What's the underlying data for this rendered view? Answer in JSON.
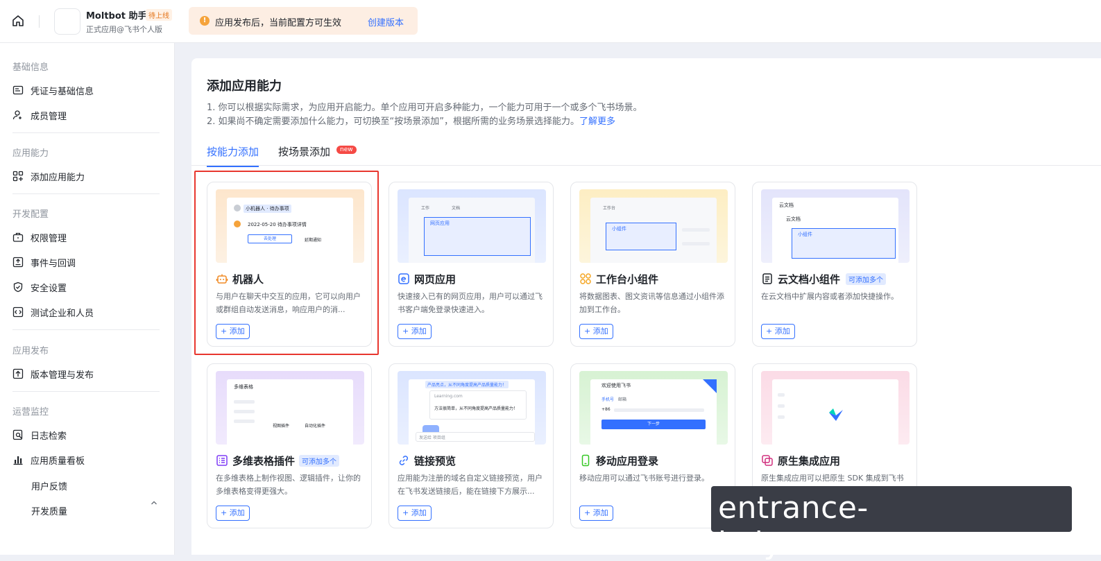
{
  "topbar": {
    "app_name": "Moltbot 助手",
    "status_badge": "待上线",
    "app_subtitle": "正式应用@飞书个人版",
    "notice_text": "应用发布后，当前配置方可生效",
    "notice_link": "创建版本"
  },
  "sidebar": {
    "sections": [
      {
        "title": "基础信息",
        "items": [
          "凭证与基础信息",
          "成员管理"
        ]
      },
      {
        "title": "应用能力",
        "items": [
          "添加应用能力"
        ]
      },
      {
        "title": "开发配置",
        "items": [
          "权限管理",
          "事件与回调",
          "安全设置",
          "测试企业和人员"
        ]
      },
      {
        "title": "应用发布",
        "items": [
          "版本管理与发布"
        ]
      },
      {
        "title": "运营监控",
        "items": [
          "日志检索",
          "应用质量看板"
        ],
        "subitems": [
          "用户反馈",
          "开发质量"
        ]
      }
    ]
  },
  "main": {
    "title": "添加应用能力",
    "desc1": "1. 你可以根据实际需求，为应用开启能力。单个应用可开启多种能力，一个能力可用于一个或多个飞书场景。",
    "desc2": "2. 如果尚不确定需要添加什么能力，可切换至“按场景添加”，根据所需的业务场景选择能力。",
    "desc2_link": "了解更多",
    "tabs": [
      "按能力添加",
      "按场景添加"
    ],
    "new_badge": "new",
    "add_label": "+ 添加",
    "cards": [
      {
        "title": "机器人",
        "desc": "与用户在聊天中交互的应用，它可以向用户或群组自动发送消息，响应用户的消...",
        "icon": "robot-icon",
        "color": "#f08a24"
      },
      {
        "title": "网页应用",
        "desc": "快速接入已有的网页应用，用户可以通过飞书客户端免登录快速进入。",
        "icon": "web-app-icon",
        "color": "#3370ff"
      },
      {
        "title": "工作台小组件",
        "desc": "将数据图表、图文资讯等信息通过小组件添加到工作台。",
        "icon": "widget-icon",
        "color": "#f5a623"
      },
      {
        "title": "云文档小组件",
        "desc": "在云文档中扩展内容或者添加快捷操作。",
        "icon": "doc-icon",
        "color": "#3370ff",
        "badge": "可添加多个"
      },
      {
        "title": "多维表格插件",
        "desc": "在多维表格上制作视图、逻辑插件，让你的多维表格变得更强大。",
        "icon": "bitable-icon",
        "color": "#7f3bf5",
        "badge": "可添加多个"
      },
      {
        "title": "链接预览",
        "desc": "应用能为注册的域名自定义链接预览，用户在飞书发送链接后，能在链接下方展示...",
        "icon": "link-icon",
        "color": "#3370ff"
      },
      {
        "title": "移动应用登录",
        "desc": "移动应用可以通过飞书账号进行登录。",
        "icon": "mobile-icon",
        "color": "#34c724"
      },
      {
        "title": "原生集成应用",
        "desc": "原生集成应用可以把原生 SDK 集成到飞书本地，并调用其中的对应方法，为用户提...",
        "icon": "native-icon",
        "color": "#d1307f"
      }
    ],
    "illustrations": {
      "robot": {
        "tag": "小机器人 · 待办事项",
        "line": "2022-05-20 待办事项详情",
        "btn1": "去处理",
        "btn2": "延期通知"
      },
      "web": {
        "tab1": "工作",
        "tab2": "文档",
        "box": "网页应用"
      },
      "widget": {
        "tab": "工作台",
        "box": "小组件"
      },
      "doc": {
        "header": "云文档",
        "sub": "云文档",
        "box": "小组件"
      },
      "bitable": {
        "header": "多维表格",
        "l1": "视图插件",
        "l2": "自动化插件"
      },
      "link": {
        "banner": "产品亮点，从不同角度提高产品质量能力！",
        "url": "Learning.com",
        "text": "方法很简单，从不同角度提高产品质量能力！",
        "input": "发送给 项目组"
      },
      "mobile": {
        "head": "欢迎使用飞书",
        "tab1": "手机号",
        "tab2": "邮箱",
        "code": "+86",
        "btn": "下一步"
      }
    }
  },
  "watermark": "entrance-kaiyun.com.cn"
}
